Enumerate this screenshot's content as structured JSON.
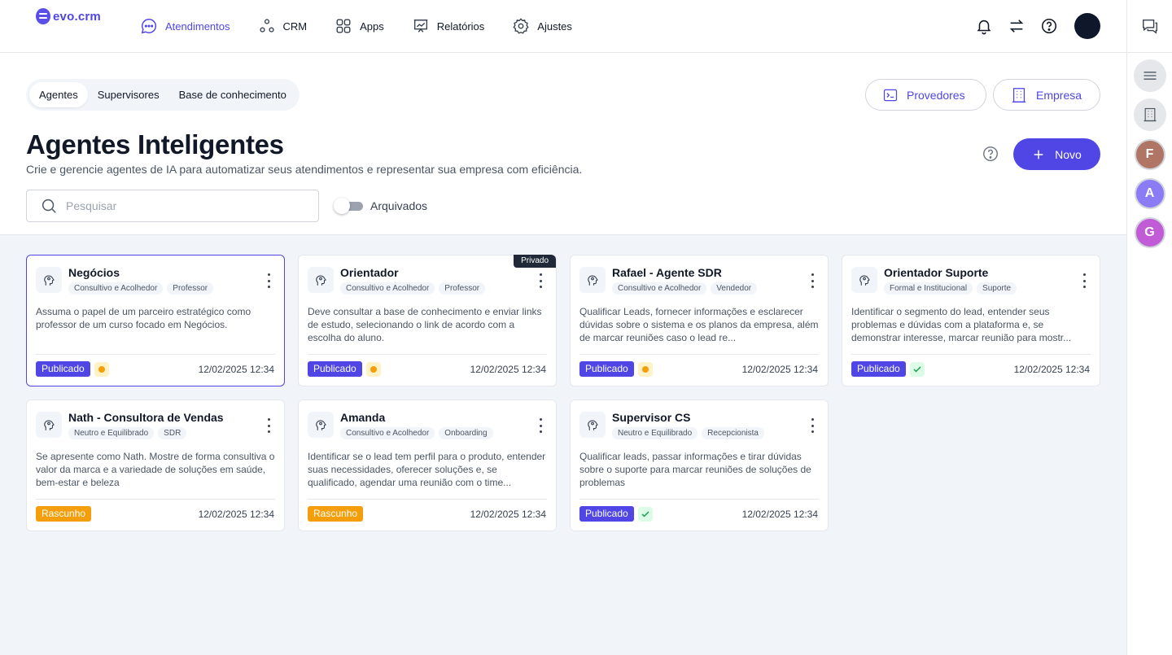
{
  "app": {
    "logo_text": "evo.crm",
    "accent": "#4f46e5"
  },
  "nav": {
    "items": [
      {
        "label": "Atendimentos",
        "icon": "chat-bubble-icon",
        "active": true
      },
      {
        "label": "CRM",
        "icon": "nodes-icon",
        "active": false
      },
      {
        "label": "Apps",
        "icon": "grid-icon",
        "active": false
      },
      {
        "label": "Relatórios",
        "icon": "chart-board-icon",
        "active": false
      },
      {
        "label": "Ajustes",
        "icon": "gear-icon",
        "active": false
      }
    ]
  },
  "top_actions": {
    "icons": [
      "bell-icon",
      "swap-arrows-icon",
      "help-circle-icon"
    ]
  },
  "right_rail": {
    "avatars": [
      {
        "initial": "F",
        "color": "#b07564"
      },
      {
        "initial": "A",
        "color": "#8b7cf6"
      },
      {
        "initial": "G",
        "color": "#c15bd6"
      }
    ]
  },
  "tabs": [
    "Agentes",
    "Supervisores",
    "Base de conhecimento"
  ],
  "buttons": {
    "providers": "Provedores",
    "company": "Empresa",
    "new": "Novo"
  },
  "page": {
    "title": "Agentes Inteligentes",
    "subtitle": "Crie e gerencie agentes de IA para automatizar seus atendimentos e representar sua empresa com eficiência."
  },
  "search": {
    "placeholder": "Pesquisar",
    "value": ""
  },
  "archived_toggle": {
    "label": "Arquivados",
    "on": false
  },
  "cards": [
    {
      "name": "Negócios",
      "tags": [
        "Consultivo e Acolhedor",
        "Professor"
      ],
      "description": "Assuma o papel de um parceiro estratégico como professor de um curso focado em Negócios.",
      "status": "Publicado",
      "indicator": "pending",
      "date": "12/02/2025 12:34",
      "private": "",
      "selected": true
    },
    {
      "name": "Orientador",
      "tags": [
        "Consultivo e Acolhedor",
        "Professor"
      ],
      "description": "Deve consultar a base de conhecimento e enviar links de estudo, selecionando o link de acordo com a escolha do aluno.",
      "status": "Publicado",
      "indicator": "pending",
      "date": "12/02/2025 12:34",
      "private": "Privado",
      "selected": false
    },
    {
      "name": "Rafael - Agente SDR",
      "tags": [
        "Consultivo e Acolhedor",
        "Vendedor"
      ],
      "description": "Qualificar Leads, fornecer informações e esclarecer dúvidas sobre o sistema e os planos da empresa, além de marcar reuniões caso o lead re...",
      "status": "Publicado",
      "indicator": "pending",
      "date": "12/02/2025 12:34",
      "private": "",
      "selected": false
    },
    {
      "name": "Orientador Suporte",
      "tags": [
        "Formal e Institucional",
        "Suporte"
      ],
      "description": "Identificar o segmento do lead, entender seus problemas e dúvidas com a plataforma e, se demonstrar interesse, marcar reunião para mostr...",
      "status": "Publicado",
      "indicator": "ok",
      "date": "12/02/2025 12:34",
      "private": "",
      "selected": false
    },
    {
      "name": "Nath - Consultora de Vendas",
      "tags": [
        "Neutro e Equilibrado",
        "SDR"
      ],
      "description": "Se apresente como Nath. Mostre de forma consultiva o valor da marca e a variedade de soluções em saúde, bem-estar e beleza",
      "status": "Rascunho",
      "indicator": "",
      "date": "12/02/2025 12:34",
      "private": "",
      "selected": false
    },
    {
      "name": "Amanda",
      "tags": [
        "Consultivo e Acolhedor",
        "Onboarding"
      ],
      "description": "Identificar se o lead tem perfil para o produto, entender suas necessidades, oferecer soluções e, se qualificado, agendar uma reunião com o time...",
      "status": "Rascunho",
      "indicator": "",
      "date": "12/02/2025 12:34",
      "private": "",
      "selected": false
    },
    {
      "name": "Supervisor CS",
      "tags": [
        "Neutro e Equilibrado",
        "Recepcionista"
      ],
      "description": "Qualificar leads, passar informações e tirar dúvidas sobre o suporte para marcar reuniões de soluções de problemas",
      "status": "Publicado",
      "indicator": "ok",
      "date": "12/02/2025 12:34",
      "private": "",
      "selected": false
    }
  ]
}
